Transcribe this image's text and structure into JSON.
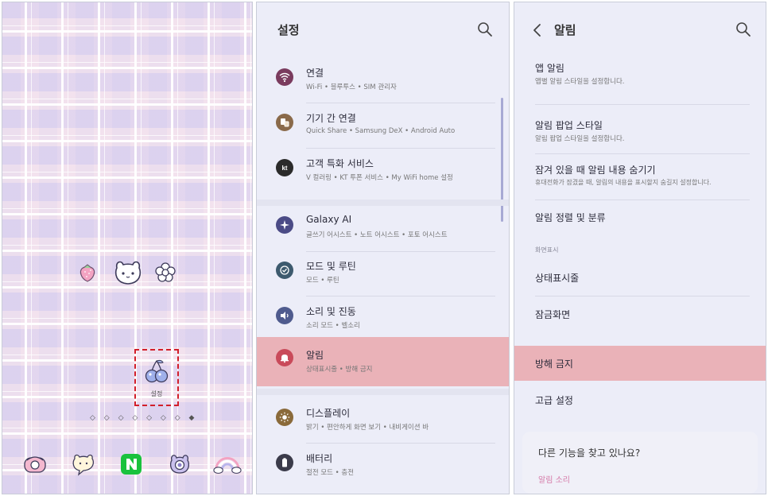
{
  "home": {
    "settings_app_label": "설정",
    "page_indicator": "◇ ◇ ◇ ◇ ◇ ◇ ◇ ◆"
  },
  "settings": {
    "title": "설정",
    "items": [
      {
        "title": "연결",
        "subtitle": "Wi-Fi • 블루투스 • SIM 관리자",
        "icon": "wifi-icon",
        "color": "#7a3b5e"
      },
      {
        "title": "기기 간 연결",
        "subtitle": "Quick Share • Samsung DeX • Android Auto",
        "icon": "devices-icon",
        "color": "#8a6a4a"
      },
      {
        "title": "고객 특화 서비스",
        "subtitle": "V 컬러링 • KT 투폰 서비스 • My WiFi home 설정",
        "icon": "kt-icon",
        "color": "#2b2b2b"
      },
      {
        "title": "Galaxy AI",
        "subtitle": "글쓰기 어시스트 • 노트 어시스트 • 포토 어시스트",
        "icon": "sparkle-icon",
        "color": "#4b4b86"
      },
      {
        "title": "모드 및 루틴",
        "subtitle": "모드 • 루틴",
        "icon": "check-circle-icon",
        "color": "#3d5a6e"
      },
      {
        "title": "소리 및 진동",
        "subtitle": "소리 모드 • 벨소리",
        "icon": "speaker-icon",
        "color": "#4f5b8e"
      },
      {
        "title": "알림",
        "subtitle": "상태표시줄 • 방해 금지",
        "icon": "bell-icon",
        "color": "#c94a5a"
      },
      {
        "title": "디스플레이",
        "subtitle": "밝기 • 편안하게 화면 보기 • 내비게이션 바",
        "icon": "sun-icon",
        "color": "#8a6a3a"
      },
      {
        "title": "배터리",
        "subtitle": "절전 모드 • 충전",
        "icon": "battery-icon",
        "color": "#3b3b4a"
      }
    ]
  },
  "noti": {
    "title": "알림",
    "app_title": "앱 알림",
    "app_sub": "앱별 알림 스타일을 설정합니다.",
    "popup_title": "알림 팝업 스타일",
    "popup_sub": "알림 팝업 스타일을 설정합니다.",
    "lock_title": "잠겨 있을 때 알림 내용 숨기기",
    "lock_sub": "휴대전화가 잠겼을 때, 알림의 내용을 표시할지 숨길지 설정합니다.",
    "sort_title": "알림 정렬 및 분류",
    "section": "화면표시",
    "status_bar": "상태표시줄",
    "lock_screen": "잠금화면",
    "dnd": "방해 금지",
    "advanced": "고급 설정",
    "find_q": "다른 기능을 찾고 있나요?",
    "find_link": "알림 소리"
  }
}
